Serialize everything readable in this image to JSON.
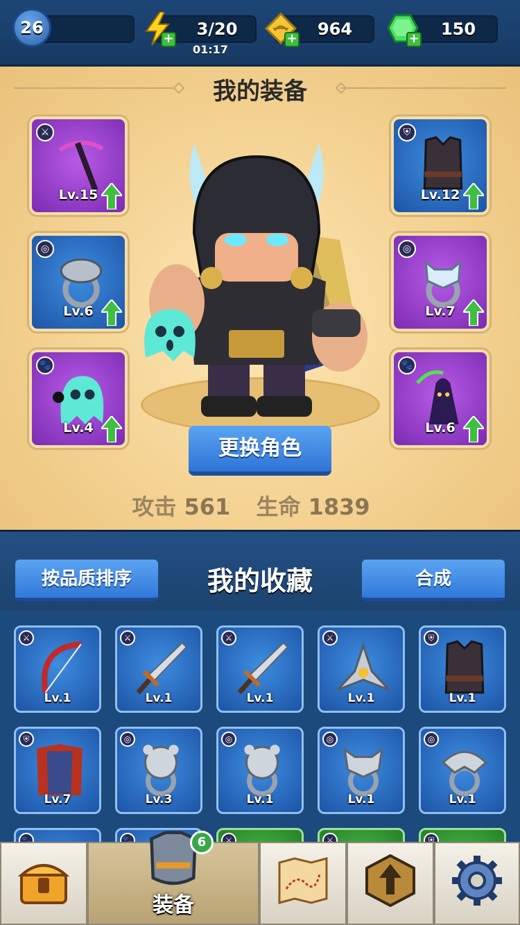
{
  "topbar": {
    "player_level": "26",
    "energy": "3/20",
    "energy_timer": "01:17",
    "gold": "964",
    "gems": "150"
  },
  "equipment": {
    "title": "我的装备",
    "slots": [
      {
        "level": "Lv.15",
        "icon": "weapon-icon",
        "art": "scythe-icon"
      },
      {
        "level": "Lv.6",
        "icon": "ring-icon",
        "art": "snake-ring-icon"
      },
      {
        "level": "Lv.4",
        "icon": "pet-icon",
        "art": "ghost-pet-icon"
      },
      {
        "level": "Lv.12",
        "icon": "armor-icon",
        "art": "vest-icon"
      },
      {
        "level": "Lv.7",
        "icon": "ring-icon",
        "art": "wolf-ring-icon"
      },
      {
        "level": "Lv.6",
        "icon": "pet-icon",
        "art": "reaper-pet-icon"
      }
    ],
    "change_hero_button": "更换角色",
    "attack_label": "攻击",
    "attack_value": "561",
    "hp_label": "生命",
    "hp_value": "1839"
  },
  "collection": {
    "sort_button": "按品质排序",
    "title": "我的收藏",
    "merge_button": "合成",
    "items": [
      {
        "level": "Lv.1",
        "icon": "weapon-icon",
        "art": "bow-icon"
      },
      {
        "level": "Lv.1",
        "icon": "weapon-icon",
        "art": "sword-icon"
      },
      {
        "level": "Lv.1",
        "icon": "weapon-icon",
        "art": "sword-icon"
      },
      {
        "level": "Lv.1",
        "icon": "weapon-icon",
        "art": "shuriken-icon"
      },
      {
        "level": "Lv.1",
        "icon": "armor-icon",
        "art": "vest-icon"
      },
      {
        "level": "Lv.7",
        "icon": "armor-icon",
        "art": "robe-icon"
      },
      {
        "level": "Lv.3",
        "icon": "ring-icon",
        "art": "bear-ring-icon"
      },
      {
        "level": "Lv.1",
        "icon": "ring-icon",
        "art": "bear-ring-icon"
      },
      {
        "level": "Lv.1",
        "icon": "ring-icon",
        "art": "wolf-ring-icon"
      },
      {
        "level": "Lv.1",
        "icon": "ring-icon",
        "art": "falcon-ring-icon"
      }
    ]
  },
  "nav": {
    "equipment_label": "装备",
    "equipment_badge": "6"
  },
  "colors": {
    "purple_slot": "#7b2bb3",
    "blue_slot": "#1d54a6",
    "upgrade_arrow": "#3fbf3f",
    "button_blue": "#3178d8"
  }
}
